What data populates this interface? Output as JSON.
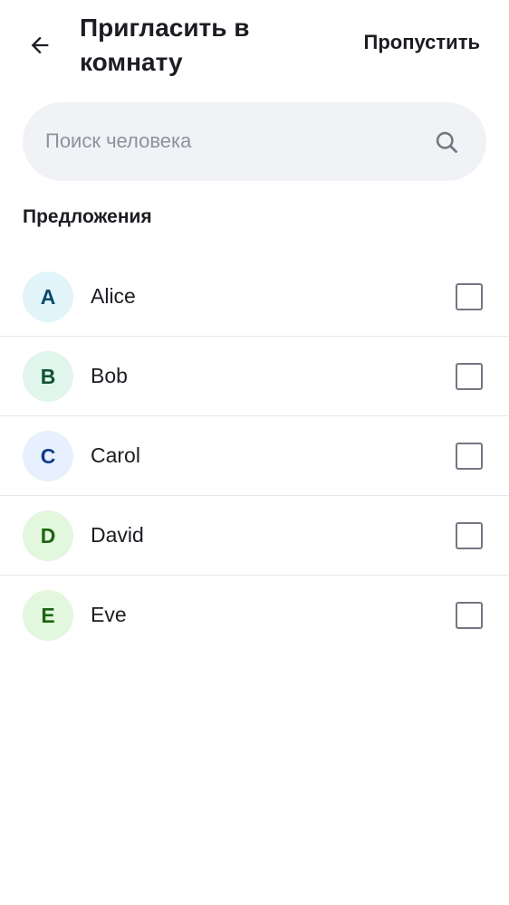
{
  "header": {
    "back_icon": "arrow-left-icon",
    "title": "Пригласить в комнату",
    "skip_label": "Пропустить"
  },
  "search": {
    "placeholder": "Поиск человека",
    "value": "",
    "icon": "search-icon"
  },
  "suggestions": {
    "title": "Предложения",
    "items": [
      {
        "initial": "A",
        "name": "Alice",
        "avatar_bg": "#e1f4fa",
        "avatar_fg": "#0d4a6b",
        "checked": false
      },
      {
        "initial": "B",
        "name": "Bob",
        "avatar_bg": "#e0f6ec",
        "avatar_fg": "#0f5232",
        "checked": false
      },
      {
        "initial": "C",
        "name": "Carol",
        "avatar_bg": "#e6f1fd",
        "avatar_fg": "#0f3a8c",
        "checked": false
      },
      {
        "initial": "D",
        "name": "David",
        "avatar_bg": "#e2f7dd",
        "avatar_fg": "#1c6410",
        "checked": false
      },
      {
        "initial": "E",
        "name": "Eve",
        "avatar_bg": "#e2f7dd",
        "avatar_fg": "#1c6410",
        "checked": false
      }
    ]
  }
}
